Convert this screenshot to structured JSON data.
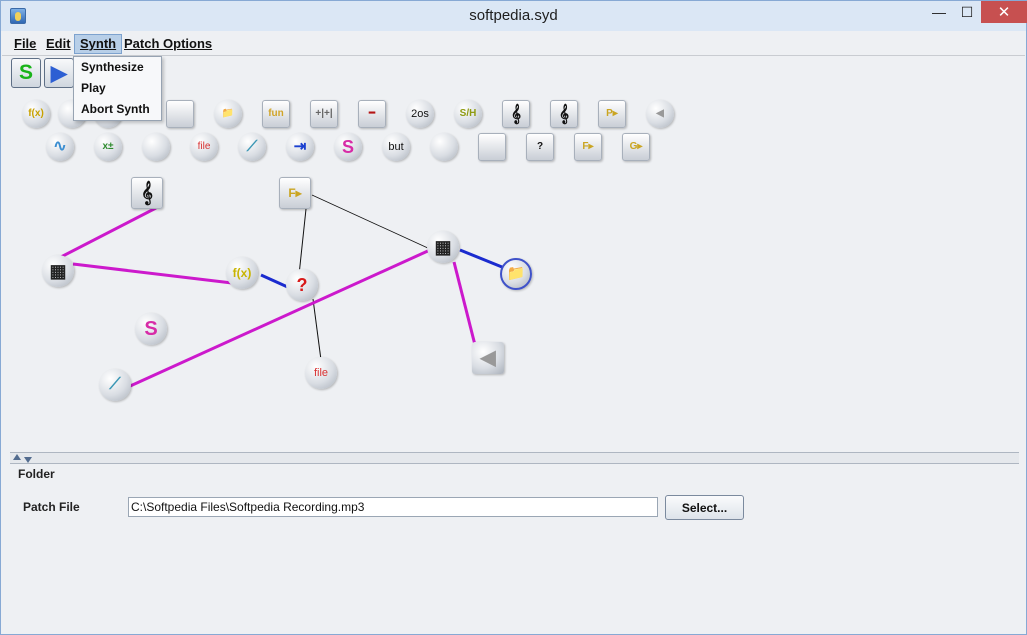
{
  "window": {
    "title": "softpedia.syd",
    "minimize_glyph": "—",
    "maximize_glyph": "☐",
    "close_glyph": "✕"
  },
  "menubar": {
    "items": [
      "File",
      "Edit",
      "Synth",
      "Patch Options"
    ],
    "active": "Synth"
  },
  "toolbar": {
    "synthesize_glyph": "S",
    "play_glyph": "▶"
  },
  "synth_menu": {
    "items": [
      "Synthesize",
      "Play",
      "Abort Synth"
    ]
  },
  "palette": {
    "row1": [
      "f(x)",
      "",
      "",
      "",
      "📁",
      "fun",
      "+|+|",
      "━",
      "",
      "2os",
      "S/H",
      "𝄞",
      "𝄞",
      "P▸",
      "◀"
    ],
    "row2": [
      "∿",
      "x±",
      "",
      "file",
      "⟋",
      "⇥",
      "S",
      "but",
      "",
      "",
      "?",
      "F▸",
      "G▸"
    ]
  },
  "nodes": [
    {
      "id": "score-node",
      "glyph": "𝄞"
    },
    {
      "id": "file-output-node",
      "glyph": "F▸"
    },
    {
      "id": "piano-node-left",
      "glyph": "▦"
    },
    {
      "id": "function-node",
      "glyph": "f(x)"
    },
    {
      "id": "random-node",
      "glyph": "?"
    },
    {
      "id": "piano-node-right",
      "glyph": "▦"
    },
    {
      "id": "folder-node",
      "glyph": "📁"
    },
    {
      "id": "synth-node",
      "glyph": "S"
    },
    {
      "id": "envelope-node",
      "glyph": "⟋"
    },
    {
      "id": "file-node",
      "glyph": "file"
    },
    {
      "id": "speaker-node",
      "glyph": "◀"
    }
  ],
  "properties": {
    "section_title": "Folder",
    "patch_file_label": "Patch File",
    "patch_file_value": "C:\\Softpedia Files\\Softpedia Recording.mp3",
    "select_label": "Select..."
  },
  "colors": {
    "wire_magenta": "#cc19cc",
    "wire_blue": "#1a2bcf",
    "wire_black": "#111111"
  }
}
